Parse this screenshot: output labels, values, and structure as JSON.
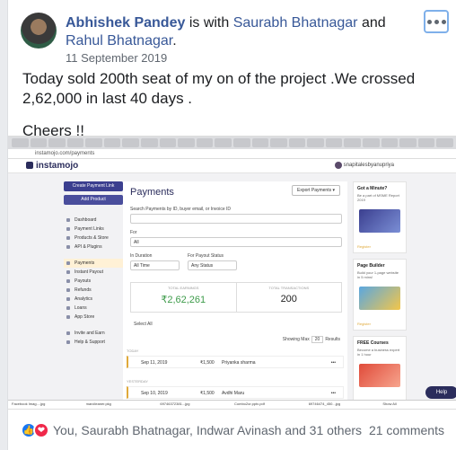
{
  "post": {
    "author": "Abhishek Pandey",
    "with_text": " is with ",
    "tag1": "Saurabh Bhatnagar",
    "and_text": " and ",
    "tag2": "Rahul Bhatnagar",
    "tail": ".",
    "date": "11 September 2019",
    "text_line1": "Today sold 200th seat of my on of the project .We crossed 2,62,000 in last 40 days .",
    "text_line2": "Cheers !!"
  },
  "screenshot": {
    "url": "instamojo.com/payments",
    "logo": "instamojo",
    "user": "snapitalesbyanupriya",
    "create_link_label": "Create Payment Link",
    "add_product_label": "Add Product",
    "nav": [
      "Dashboard",
      "Payment Links",
      "Products & Store",
      "API & Plugins"
    ],
    "nav2": [
      "Payments",
      "Instant Payout",
      "Payouts",
      "Refunds",
      "Analytics",
      "Loans",
      "App Store"
    ],
    "nav3": [
      "Invite and Earn",
      "Help & Support"
    ],
    "page_title": "Payments",
    "export_label": "Export Payments ▾",
    "search_label": "Search Payments by ID, buyer email, or Invoice ID",
    "for_label": "For",
    "for_value": "All",
    "duration_label": "In Duration",
    "duration_value": "All Time",
    "payout_label": "For Payout Status",
    "payout_value": "Any Status",
    "total_earnings_cap": "TOTAL EARNINGS",
    "total_earnings": "₹2,62,261",
    "total_tx_cap": "TOTAL TRANSACTIONS",
    "total_tx": "200",
    "select_all": "Select All",
    "showing_max": "Showing Max",
    "showing_count": "20",
    "results": "Results",
    "group_today": "TODAY",
    "group_yesterday": "YESTERDAY",
    "rows": [
      {
        "date": "Sep 11, 2019",
        "amount": "₹1,500",
        "name": "Priyanka sharma"
      },
      {
        "date": "Sep 10, 2019",
        "amount": "₹1,500",
        "name": "Avdhi Maru"
      }
    ],
    "promo1_title": "Got a Minute?",
    "promo1_text": "Be a part of MSME Report 2019",
    "promo2_title": "Page Builder",
    "promo2_text": "Build your 1-page website in 5 mins!",
    "promo3_title": "FREE Courses",
    "promo3_text": "Become a business expert in 1 hour",
    "register": "Register",
    "help_label": "Help",
    "downloads": [
      "Facebook Imag....jpg",
      "marcileaner.pkg",
      "69746372381...jpg",
      "Combo2or.pptx.pdf",
      "69746474_450...jpg",
      "Show All"
    ]
  },
  "footer": {
    "reactions_text": "You, Saurabh Bhatnagar, Indwar Avinash and 31 others",
    "comments": "21 comments"
  },
  "colors": {
    "link": "#385898",
    "like": "#1877f2",
    "love": "#f0284a",
    "earnings_green": "#3d9b4a"
  }
}
